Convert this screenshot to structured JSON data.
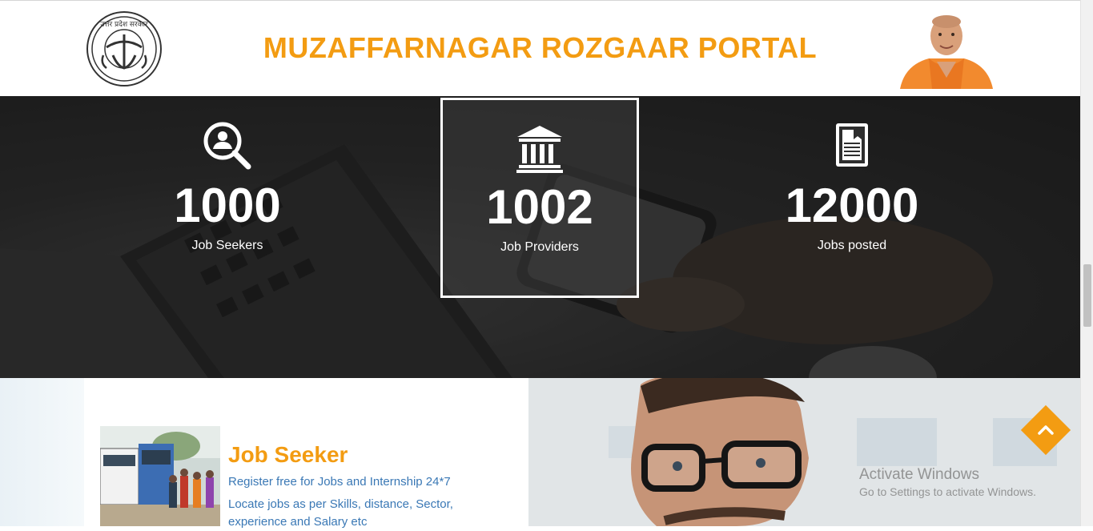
{
  "header": {
    "title": "MUZAFFARNAGAR ROZGAAR PORTAL",
    "emblem_text": "उत्तर प्रदेश सरकार",
    "logo_icon": "up-government-emblem",
    "portrait_icon": "chief-minister-portrait"
  },
  "stats": [
    {
      "icon": "job-seeker-search-icon",
      "number": "1000",
      "label": "Job Seekers",
      "active": false
    },
    {
      "icon": "institution-building-icon",
      "number": "1002",
      "label": "Job Providers",
      "active": true
    },
    {
      "icon": "document-icon",
      "number": "12000",
      "label": "Jobs posted",
      "active": false
    }
  ],
  "job_seeker": {
    "title": "Job Seeker",
    "lines": [
      "Register free for Jobs and Internship 24*7",
      "Locate jobs as per Skills, distance, Sector, experience and Salary etc"
    ]
  },
  "watermark": {
    "title": "Activate Windows",
    "subtitle": "Go to Settings to activate Windows."
  },
  "colors": {
    "accent": "#f39c12",
    "link_blue": "#3a78b5",
    "stats_bg": "#2e2e2e"
  }
}
